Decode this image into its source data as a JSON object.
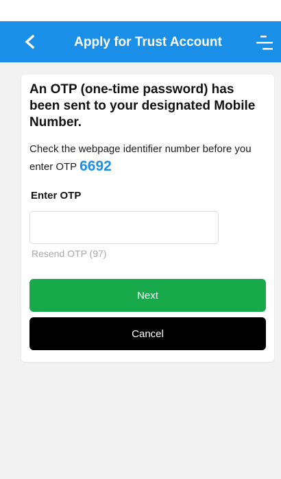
{
  "header": {
    "title": "Apply for Trust Account",
    "back_icon": "chevron-left-icon",
    "menu_icon": "menu-icon",
    "color": "#1a8fe8"
  },
  "otp": {
    "headline": "An OTP (one-time password) has been sent to your designated Mobile Number.",
    "instruction": "Check the webpage identifier number before you enter OTP",
    "webpage_identifier": "6692",
    "field_label": "Enter OTP",
    "value": "",
    "resend_label": "Resend OTP (97)"
  },
  "buttons": {
    "next_label": "Next",
    "next_color": "#17a94a",
    "cancel_label": "Cancel",
    "cancel_color": "#000000"
  }
}
